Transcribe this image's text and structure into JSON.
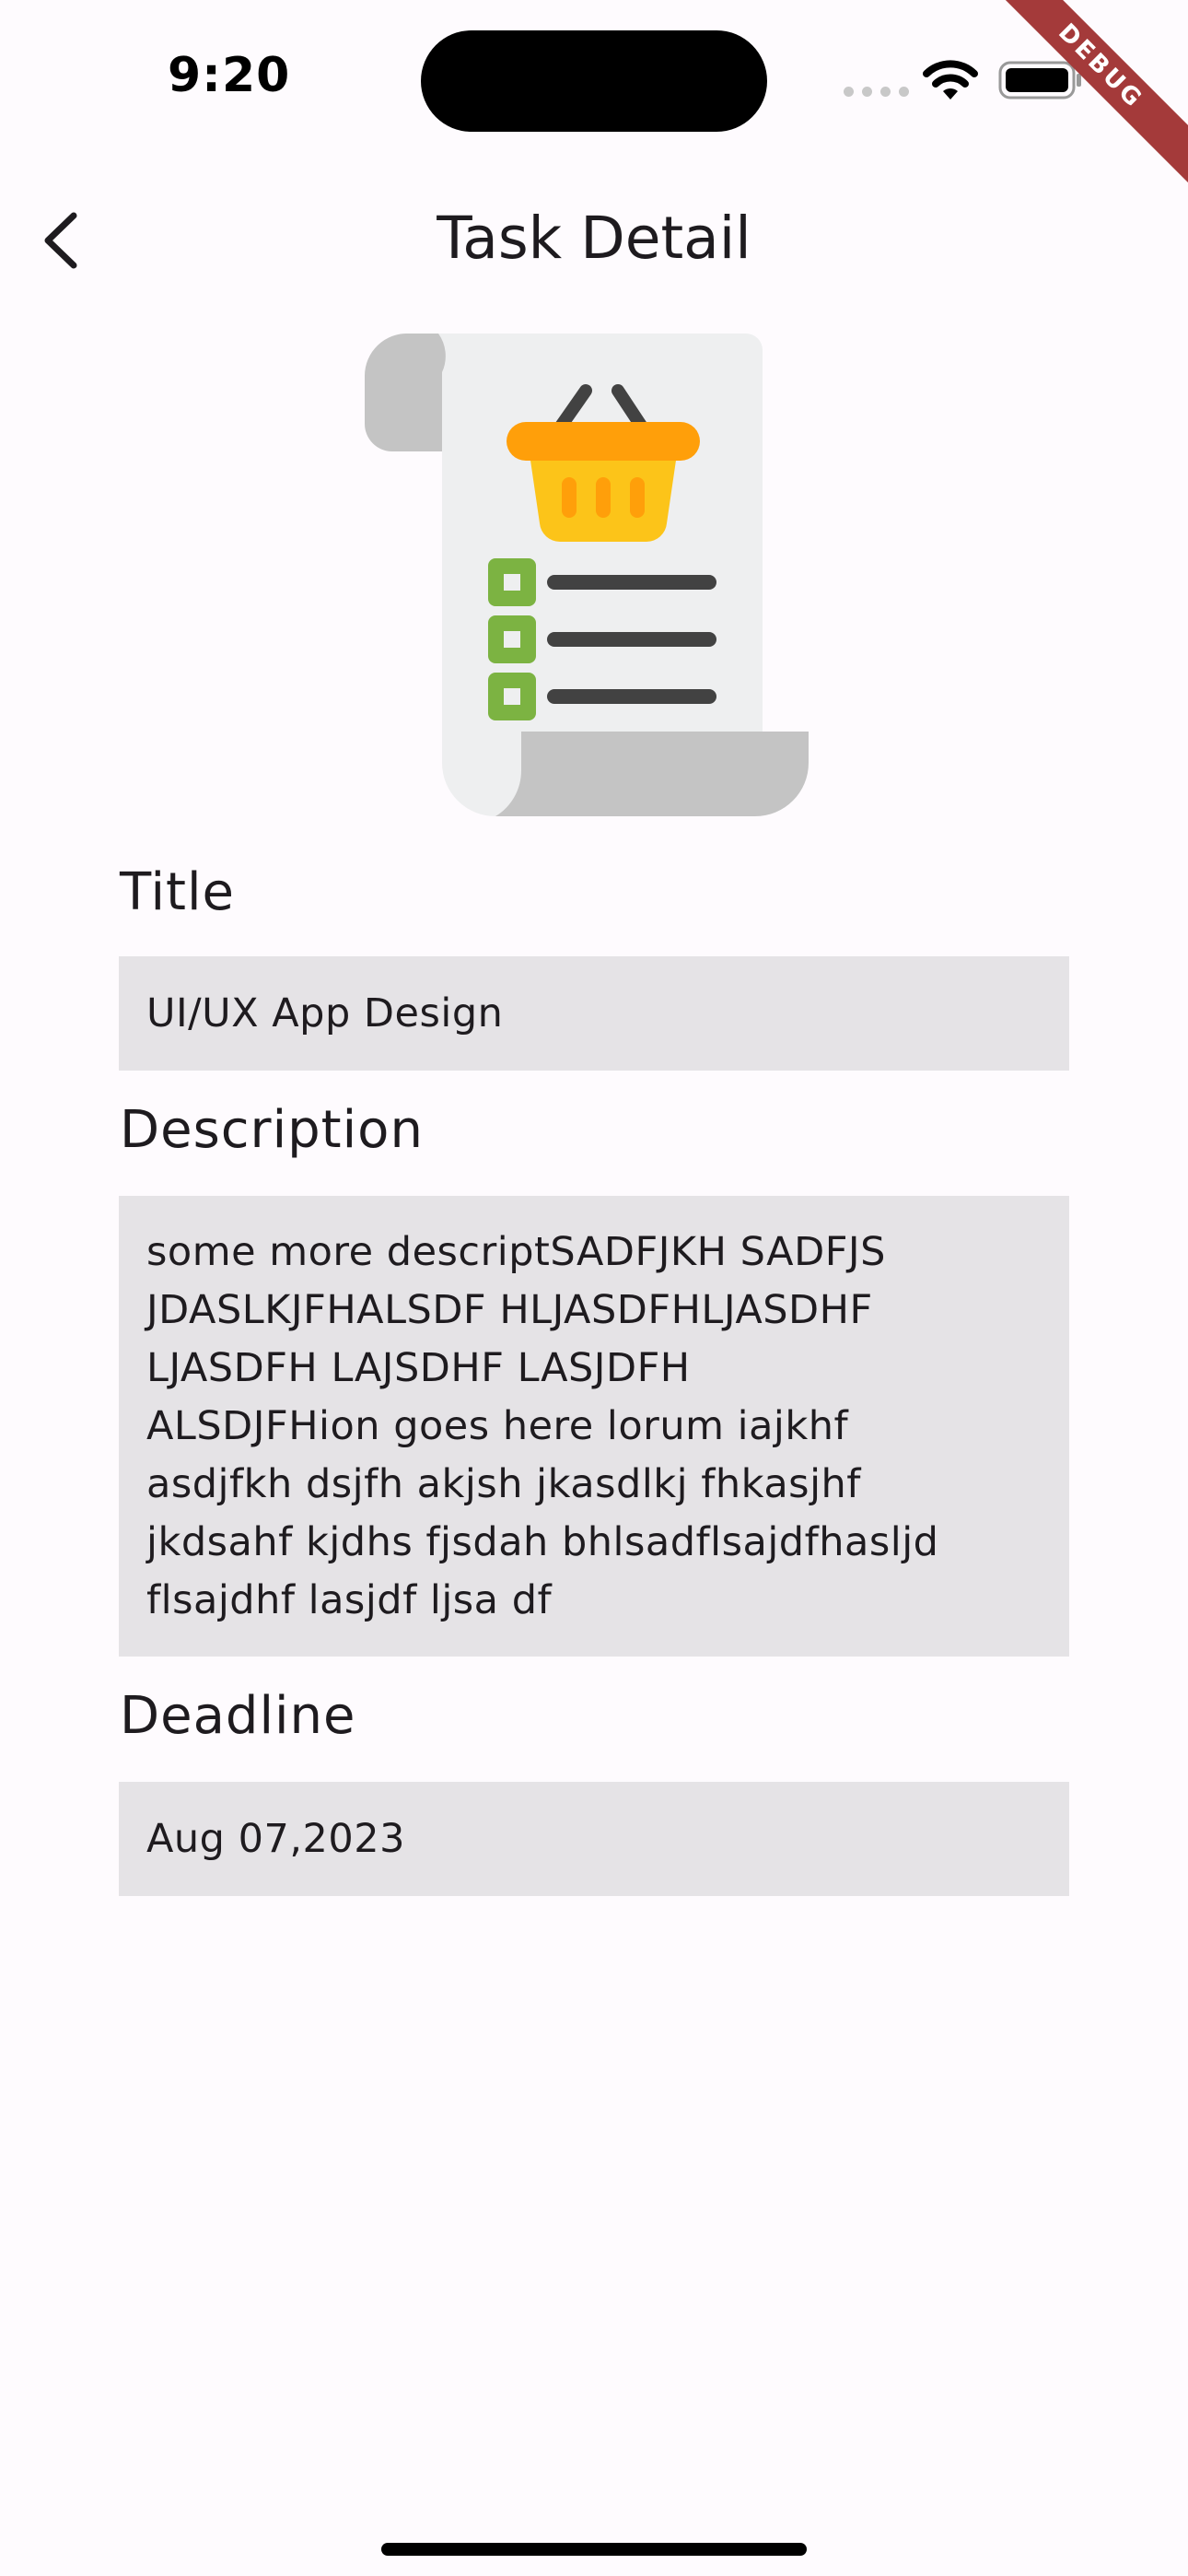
{
  "status_bar": {
    "time": "9:20",
    "debug_label": "DEBUG"
  },
  "app_bar": {
    "back_icon": "chevron-left-icon",
    "title": "Task Detail"
  },
  "illustration": {
    "icon": "shopping-list-scroll-icon",
    "colors": {
      "paper": "#eeeff0",
      "paper_shadow": "#c4c4c4",
      "basket": "#fcc419",
      "basket_rim": "#ff9f0a",
      "checkbox": "#7cb342",
      "lines": "#424242"
    }
  },
  "form": {
    "title_label": "Title",
    "title_value": "UI/UX App Design",
    "description_label": "Description",
    "description_value": "some more descriptSADFJKH SADFJS\nJDASLKJFHALSDF HLJASDFHLJASDHF\nLJASDFH LAJSDHF LASJDFH\nALSDJFHion goes here lorum iajkhf\nasdjfkh dsjfh akjsh jkasdlkj fhkasjhf\njkdsahf kjdhs fjsdah bhlsadflsajdfhasljd\nflsajdhf lasjdf ljsa df",
    "deadline_label": "Deadline",
    "deadline_value": "Aug 07,2023"
  },
  "colors": {
    "background": "#fefbfe",
    "field_background": "#e5e3e6",
    "text": "#1e1b1f",
    "debug_ribbon": "#a43a3a"
  }
}
